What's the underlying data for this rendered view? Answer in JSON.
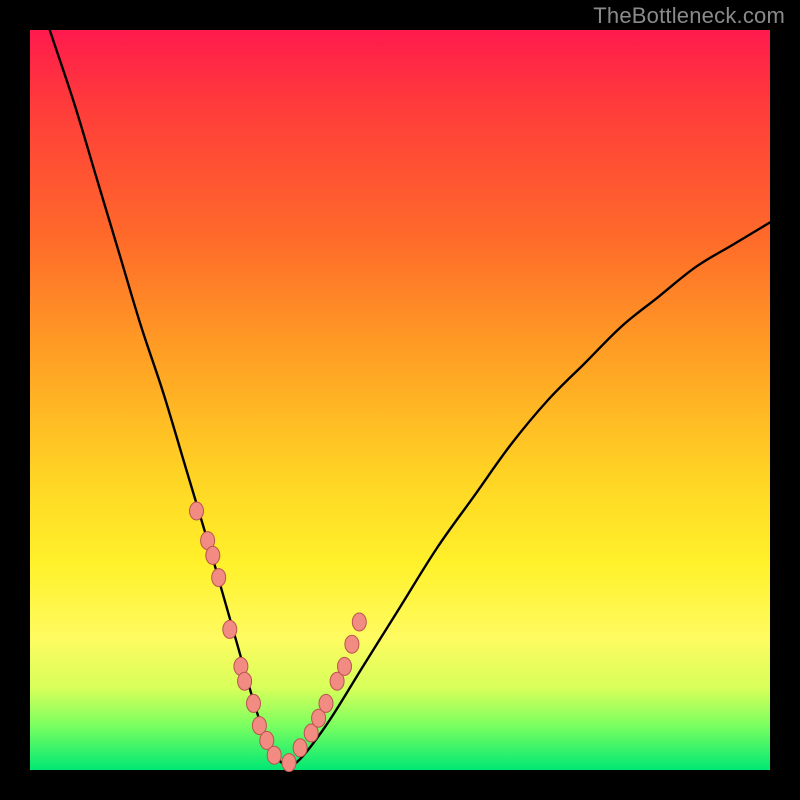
{
  "watermark": "TheBottleneck.com",
  "colors": {
    "background": "#000000",
    "gradient_top": "#ff1a4d",
    "gradient_bottom": "#00e874",
    "curve": "#000000",
    "dots_fill": "#f28b82",
    "dots_stroke": "#b85450"
  },
  "chart_data": {
    "type": "line",
    "title": "",
    "xlabel": "",
    "ylabel": "",
    "xlim": [
      0,
      100
    ],
    "ylim": [
      0,
      100
    ],
    "series": [
      {
        "name": "bottleneck-curve",
        "x": [
          0,
          3,
          6,
          9,
          12,
          15,
          18,
          21,
          24,
          26,
          28,
          30,
          32,
          34,
          36,
          40,
          45,
          50,
          55,
          60,
          65,
          70,
          75,
          80,
          85,
          90,
          95,
          100
        ],
        "y": [
          108,
          99,
          90,
          80,
          70,
          60,
          51,
          41,
          31,
          24,
          17,
          10,
          4,
          1,
          1,
          6,
          14,
          22,
          30,
          37,
          44,
          50,
          55,
          60,
          64,
          68,
          71,
          74
        ]
      }
    ],
    "dots": {
      "name": "highlight-points",
      "x": [
        22.5,
        24.0,
        24.7,
        25.5,
        27.0,
        28.5,
        29.0,
        30.2,
        31.0,
        32.0,
        33.0,
        35.0,
        36.5,
        38.0,
        39.0,
        40.0,
        41.5,
        42.5,
        43.5,
        44.5
      ],
      "y": [
        35,
        31,
        29,
        26,
        19,
        14,
        12,
        9,
        6,
        4,
        2,
        1,
        3,
        5,
        7,
        9,
        12,
        14,
        17,
        20
      ]
    }
  }
}
